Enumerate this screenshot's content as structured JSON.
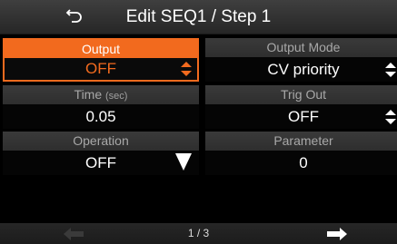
{
  "header": {
    "title": "Edit SEQ1 / Step 1",
    "back_icon": "back-arrow-icon"
  },
  "params": {
    "output": {
      "label": "Output",
      "value": "OFF",
      "control": "updown"
    },
    "output_mode": {
      "label": "Output Mode",
      "value": "CV priority",
      "control": "updown"
    },
    "time": {
      "label": "Time",
      "unit": "(sec)",
      "value": "0.05"
    },
    "trig_out": {
      "label": "Trig Out",
      "value": "OFF",
      "control": "updown"
    },
    "operation": {
      "label": "Operation",
      "value": "OFF",
      "control": "dropdown"
    },
    "parameter": {
      "label": "Parameter",
      "value": "0"
    }
  },
  "footer": {
    "page": "1 / 3",
    "prev_icon": "arrow-left-icon",
    "next_icon": "arrow-right-icon"
  },
  "colors": {
    "accent": "#f26a1e",
    "label_bg": "#333333",
    "value_bg": "#050505",
    "label_text": "#a8a8a8"
  }
}
